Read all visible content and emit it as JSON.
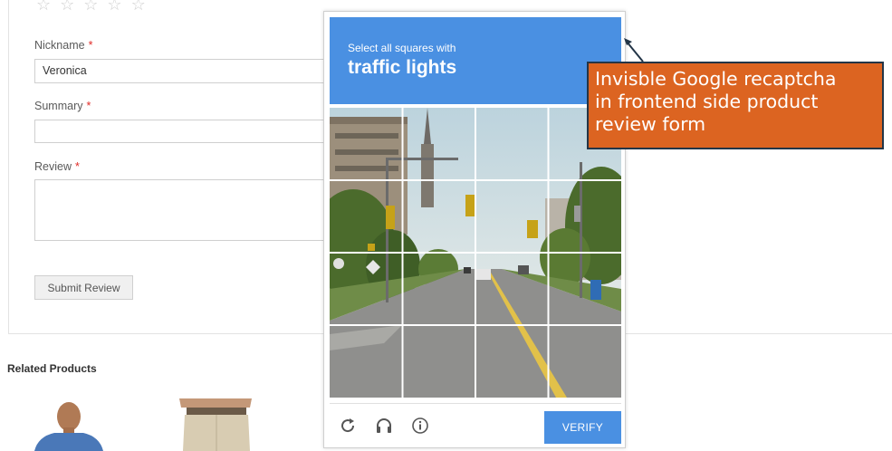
{
  "review_form": {
    "stars_count": 5,
    "nickname_label": "Nickname",
    "nickname_value": "Veronica",
    "summary_label": "Summary",
    "review_label": "Review",
    "required_marker": "*",
    "submit_label": "Submit Review"
  },
  "related": {
    "heading": "Related Products"
  },
  "captcha": {
    "instruction": "Select all squares with",
    "target": "traffic lights",
    "verify_label": "VERIFY",
    "footer_icons": [
      "reload-icon",
      "audio-headphones-icon",
      "info-icon"
    ]
  },
  "annotation": {
    "line1": "Invisble Google recaptcha",
    "line2": "in frontend side product",
    "line3": "review form"
  },
  "colors": {
    "captcha_blue": "#4a90e2",
    "annotation_orange": "#dc6421",
    "annotation_border": "#233547",
    "required_red": "#e02b27"
  }
}
